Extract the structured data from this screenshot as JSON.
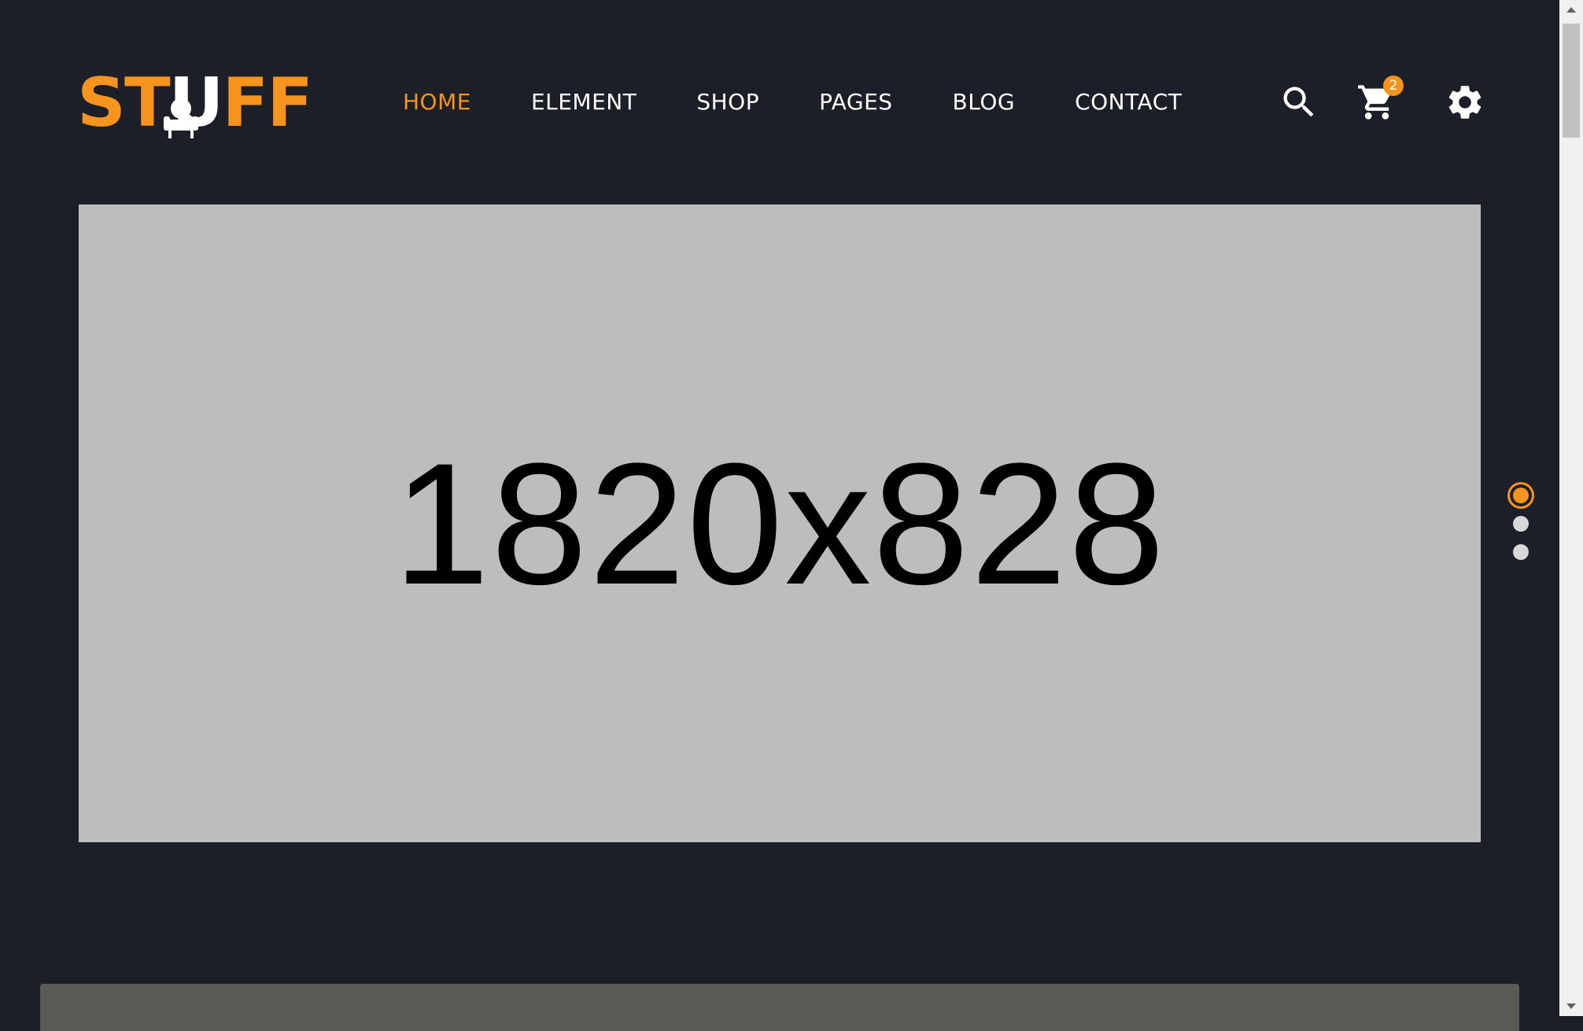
{
  "logo": {
    "part1": "ST",
    "part2": "U",
    "part3": "FF"
  },
  "nav": {
    "items": [
      {
        "label": "HOME",
        "active": true
      },
      {
        "label": "ELEMENT",
        "active": false
      },
      {
        "label": "SHOP",
        "active": false
      },
      {
        "label": "PAGES",
        "active": false
      },
      {
        "label": "BLOG",
        "active": false
      },
      {
        "label": "CONTACT",
        "active": false
      }
    ]
  },
  "header_icons": {
    "search": "search-icon",
    "cart": "cart-icon",
    "cart_count": "2",
    "settings": "gear-icon"
  },
  "hero": {
    "placeholder_text": "1820x828",
    "slide_count": 3,
    "active_slide": 1
  },
  "colors": {
    "accent": "#f7941d",
    "background": "#1c1f28",
    "placeholder": "#bdbdbd"
  }
}
